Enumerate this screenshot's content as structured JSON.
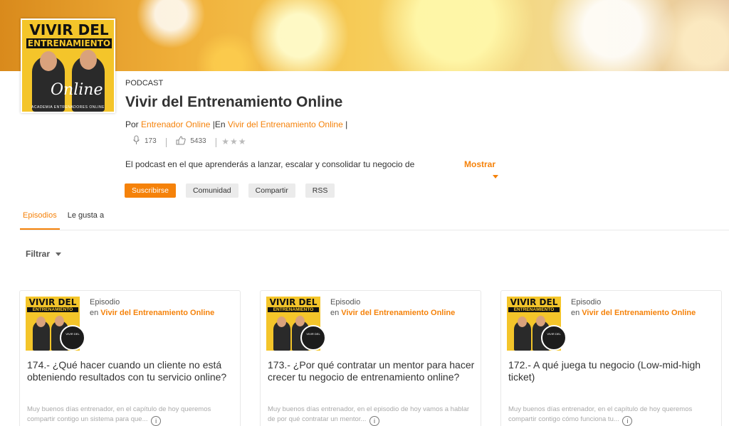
{
  "cover": {
    "title_line1": "VIVIR DEL",
    "title_line2": "ENTRENAMIENTO",
    "script_word": "Online",
    "footer_text": "ACADEMIA ENTRENADORES ONLINE"
  },
  "podcast": {
    "tag": "PODCAST",
    "title": "Vivir del Entrenamiento Online",
    "byline_prefix": "Por ",
    "author": "Entrenador Online",
    "byline_mid": " |En ",
    "channel": "Vivir del Entrenamiento Online",
    "byline_suffix": " |",
    "episodes_count": "173",
    "likes_count": "5433",
    "rating_stars": "★★★",
    "description": "El podcast en el que aprenderás a lanzar, escalar y consolidar tu negocio de",
    "show_more": "Mostrar"
  },
  "actions": {
    "subscribe": "Suscribirse",
    "community": "Comunidad",
    "share": "Compartir",
    "rss": "RSS"
  },
  "tabs": [
    {
      "label": "Episodios",
      "active": true
    },
    {
      "label": "Le gusta a",
      "active": false
    }
  ],
  "filter": {
    "label": "Filtrar"
  },
  "episodes": [
    {
      "type": "Episodio",
      "en_prefix": "en ",
      "channel": "Vivir del Entrenamiento Online",
      "title": "174.- ¿Qué hacer cuando un cliente no está obteniendo resultados con tu servicio online?",
      "description": "Muy buenos días entrenador, en el capítulo de hoy queremos compartir contigo un sistema para que..."
    },
    {
      "type": "Episodio",
      "en_prefix": "en ",
      "channel": "Vivir del Entrenamiento Online",
      "title": "173.- ¿Por qué contratar un mentor para hacer crecer tu negocio de entrenamiento online?",
      "description": "Muy buenos días entrenador, en el episodio de hoy vamos a hablar de por qué contratar un mentor..."
    },
    {
      "type": "Episodio",
      "en_prefix": "en ",
      "channel": "Vivir del Entrenamiento Online",
      "title": "172.- A qué juega tu negocio (Low-mid-high ticket)",
      "description": "Muy buenos días entrenador, en el capítulo de hoy queremos compartir contigo cómo funciona tu..."
    }
  ],
  "thumb": {
    "line1": "VIVIR DEL",
    "line2": "ENTRENAMIENTO"
  },
  "colors": {
    "accent": "#f5820a",
    "cover_yellow": "#f4c52a"
  }
}
